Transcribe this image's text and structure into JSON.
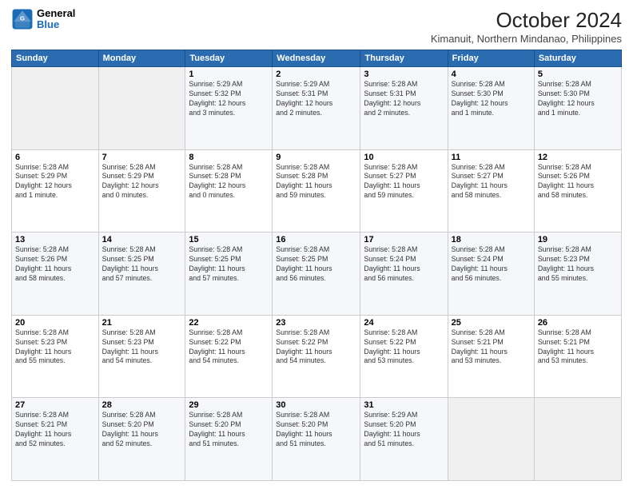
{
  "logo": {
    "line1": "General",
    "line2": "Blue"
  },
  "title": "October 2024",
  "location": "Kimanuit, Northern Mindanao, Philippines",
  "weekdays": [
    "Sunday",
    "Monday",
    "Tuesday",
    "Wednesday",
    "Thursday",
    "Friday",
    "Saturday"
  ],
  "weeks": [
    [
      {
        "day": "",
        "info": ""
      },
      {
        "day": "",
        "info": ""
      },
      {
        "day": "1",
        "info": "Sunrise: 5:29 AM\nSunset: 5:32 PM\nDaylight: 12 hours\nand 3 minutes."
      },
      {
        "day": "2",
        "info": "Sunrise: 5:29 AM\nSunset: 5:31 PM\nDaylight: 12 hours\nand 2 minutes."
      },
      {
        "day": "3",
        "info": "Sunrise: 5:28 AM\nSunset: 5:31 PM\nDaylight: 12 hours\nand 2 minutes."
      },
      {
        "day": "4",
        "info": "Sunrise: 5:28 AM\nSunset: 5:30 PM\nDaylight: 12 hours\nand 1 minute."
      },
      {
        "day": "5",
        "info": "Sunrise: 5:28 AM\nSunset: 5:30 PM\nDaylight: 12 hours\nand 1 minute."
      }
    ],
    [
      {
        "day": "6",
        "info": "Sunrise: 5:28 AM\nSunset: 5:29 PM\nDaylight: 12 hours\nand 1 minute."
      },
      {
        "day": "7",
        "info": "Sunrise: 5:28 AM\nSunset: 5:29 PM\nDaylight: 12 hours\nand 0 minutes."
      },
      {
        "day": "8",
        "info": "Sunrise: 5:28 AM\nSunset: 5:28 PM\nDaylight: 12 hours\nand 0 minutes."
      },
      {
        "day": "9",
        "info": "Sunrise: 5:28 AM\nSunset: 5:28 PM\nDaylight: 11 hours\nand 59 minutes."
      },
      {
        "day": "10",
        "info": "Sunrise: 5:28 AM\nSunset: 5:27 PM\nDaylight: 11 hours\nand 59 minutes."
      },
      {
        "day": "11",
        "info": "Sunrise: 5:28 AM\nSunset: 5:27 PM\nDaylight: 11 hours\nand 58 minutes."
      },
      {
        "day": "12",
        "info": "Sunrise: 5:28 AM\nSunset: 5:26 PM\nDaylight: 11 hours\nand 58 minutes."
      }
    ],
    [
      {
        "day": "13",
        "info": "Sunrise: 5:28 AM\nSunset: 5:26 PM\nDaylight: 11 hours\nand 58 minutes."
      },
      {
        "day": "14",
        "info": "Sunrise: 5:28 AM\nSunset: 5:25 PM\nDaylight: 11 hours\nand 57 minutes."
      },
      {
        "day": "15",
        "info": "Sunrise: 5:28 AM\nSunset: 5:25 PM\nDaylight: 11 hours\nand 57 minutes."
      },
      {
        "day": "16",
        "info": "Sunrise: 5:28 AM\nSunset: 5:25 PM\nDaylight: 11 hours\nand 56 minutes."
      },
      {
        "day": "17",
        "info": "Sunrise: 5:28 AM\nSunset: 5:24 PM\nDaylight: 11 hours\nand 56 minutes."
      },
      {
        "day": "18",
        "info": "Sunrise: 5:28 AM\nSunset: 5:24 PM\nDaylight: 11 hours\nand 56 minutes."
      },
      {
        "day": "19",
        "info": "Sunrise: 5:28 AM\nSunset: 5:23 PM\nDaylight: 11 hours\nand 55 minutes."
      }
    ],
    [
      {
        "day": "20",
        "info": "Sunrise: 5:28 AM\nSunset: 5:23 PM\nDaylight: 11 hours\nand 55 minutes."
      },
      {
        "day": "21",
        "info": "Sunrise: 5:28 AM\nSunset: 5:23 PM\nDaylight: 11 hours\nand 54 minutes."
      },
      {
        "day": "22",
        "info": "Sunrise: 5:28 AM\nSunset: 5:22 PM\nDaylight: 11 hours\nand 54 minutes."
      },
      {
        "day": "23",
        "info": "Sunrise: 5:28 AM\nSunset: 5:22 PM\nDaylight: 11 hours\nand 54 minutes."
      },
      {
        "day": "24",
        "info": "Sunrise: 5:28 AM\nSunset: 5:22 PM\nDaylight: 11 hours\nand 53 minutes."
      },
      {
        "day": "25",
        "info": "Sunrise: 5:28 AM\nSunset: 5:21 PM\nDaylight: 11 hours\nand 53 minutes."
      },
      {
        "day": "26",
        "info": "Sunrise: 5:28 AM\nSunset: 5:21 PM\nDaylight: 11 hours\nand 53 minutes."
      }
    ],
    [
      {
        "day": "27",
        "info": "Sunrise: 5:28 AM\nSunset: 5:21 PM\nDaylight: 11 hours\nand 52 minutes."
      },
      {
        "day": "28",
        "info": "Sunrise: 5:28 AM\nSunset: 5:20 PM\nDaylight: 11 hours\nand 52 minutes."
      },
      {
        "day": "29",
        "info": "Sunrise: 5:28 AM\nSunset: 5:20 PM\nDaylight: 11 hours\nand 51 minutes."
      },
      {
        "day": "30",
        "info": "Sunrise: 5:28 AM\nSunset: 5:20 PM\nDaylight: 11 hours\nand 51 minutes."
      },
      {
        "day": "31",
        "info": "Sunrise: 5:29 AM\nSunset: 5:20 PM\nDaylight: 11 hours\nand 51 minutes."
      },
      {
        "day": "",
        "info": ""
      },
      {
        "day": "",
        "info": ""
      }
    ]
  ]
}
